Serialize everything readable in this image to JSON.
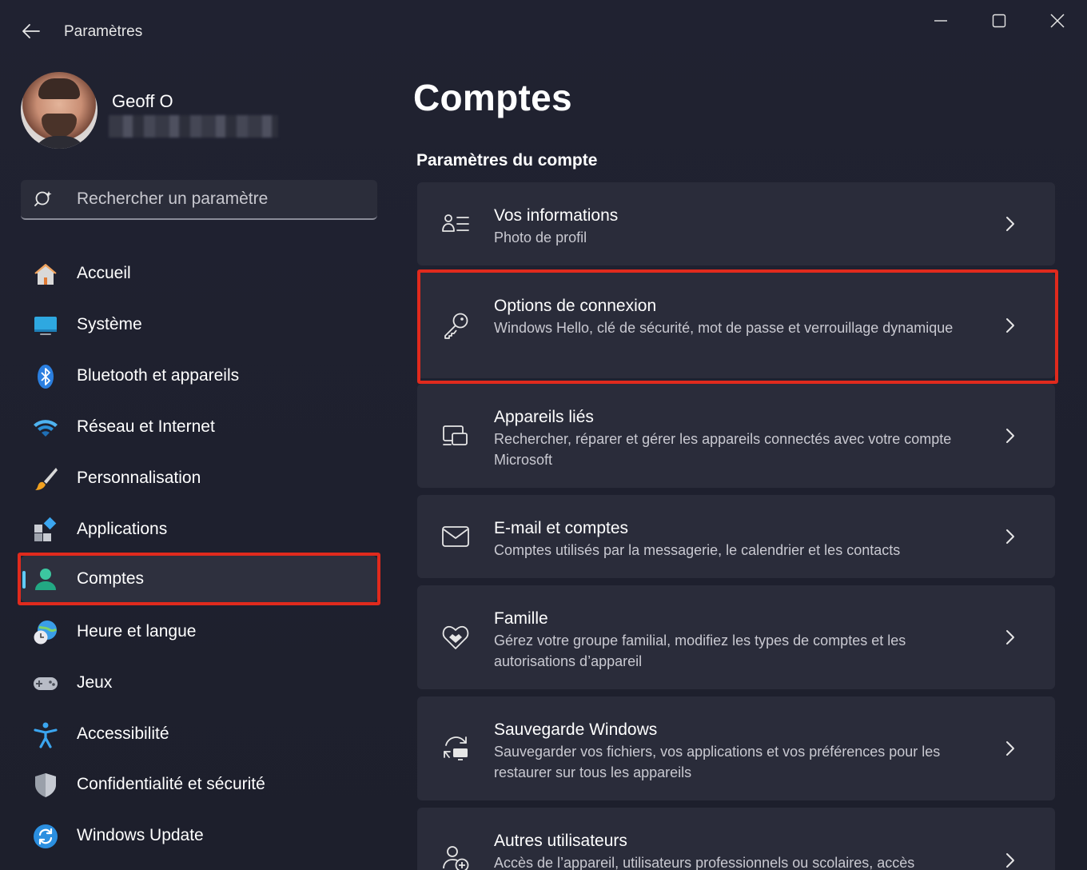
{
  "window": {
    "title": "Paramètres",
    "controls": {
      "minimize": "minimize",
      "maximize": "maximize",
      "close": "close"
    }
  },
  "profile": {
    "name": "Geoff O"
  },
  "search": {
    "placeholder": "Rechercher un paramètre"
  },
  "nav": {
    "items": [
      {
        "label": "Accueil",
        "icon": "home-icon"
      },
      {
        "label": "Système",
        "icon": "system-icon"
      },
      {
        "label": "Bluetooth et appareils",
        "icon": "bluetooth-icon"
      },
      {
        "label": "Réseau et Internet",
        "icon": "wifi-icon"
      },
      {
        "label": "Personnalisation",
        "icon": "brush-icon"
      },
      {
        "label": "Applications",
        "icon": "apps-icon"
      },
      {
        "label": "Comptes",
        "icon": "account-icon",
        "selected": true
      },
      {
        "label": "Heure et langue",
        "icon": "globe-clock-icon"
      },
      {
        "label": "Jeux",
        "icon": "gamepad-icon"
      },
      {
        "label": "Accessibilité",
        "icon": "accessibility-icon"
      },
      {
        "label": "Confidentialité et sécurité",
        "icon": "shield-icon"
      },
      {
        "label": "Windows Update",
        "icon": "update-icon"
      }
    ]
  },
  "main": {
    "page_title": "Comptes",
    "section_title": "Paramètres du compte",
    "cards": [
      {
        "title": "Vos informations",
        "desc": "Photo de profil",
        "icon": "person-info-icon"
      },
      {
        "title": "Options de connexion",
        "desc": "Windows Hello, clé de sécurité, mot de passe et verrouillage dynamique",
        "icon": "key-icon"
      },
      {
        "title": "Appareils liés",
        "desc": "Rechercher, réparer et gérer les appareils connectés avec votre compte Microsoft",
        "icon": "linked-devices-icon"
      },
      {
        "title": "E-mail et comptes",
        "desc": "Comptes utilisés par la messagerie, le calendrier et les contacts",
        "icon": "mail-icon"
      },
      {
        "title": "Famille",
        "desc": "Gérez votre groupe familial, modifiez les types de comptes et les autorisations d’appareil",
        "icon": "family-heart-icon"
      },
      {
        "title": "Sauvegarde Windows",
        "desc": "Sauvegarder vos fichiers, vos applications et vos préférences pour les restaurer sur tous les appareils",
        "icon": "backup-icon"
      },
      {
        "title": "Autres utilisateurs",
        "desc": "Accès de l’appareil, utilisateurs professionnels ou scolaires, accès",
        "icon": "add-user-icon"
      }
    ]
  },
  "colors": {
    "accent": "#60cdff",
    "highlight": "#e02a1d",
    "card_bg": "#2a2c3a",
    "window_bg": "#1f2030"
  }
}
